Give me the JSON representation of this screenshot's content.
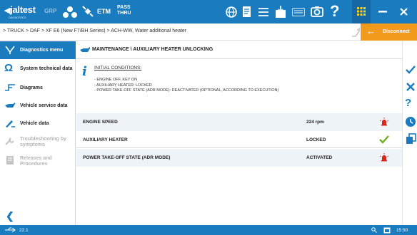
{
  "topbar": {
    "logo_brand": "jaltest",
    "logo_sub": "DIAGNOSTICS",
    "grp": "GRP",
    "etm": "ETM",
    "pass": "PASS",
    "thru": "THRU"
  },
  "breadcrumb": "> TRUCK > DAF > XF E6 (New F7/BH Series) > ACH-WW, Water additional heater",
  "disconnect_label": "Disconnect",
  "sidebar": {
    "items": [
      {
        "label": "Diagnostics menu"
      },
      {
        "label": "System technical data"
      },
      {
        "label": "Diagrams"
      },
      {
        "label": "Vehicle service data"
      },
      {
        "label": "Vehicle data"
      },
      {
        "label": "Troubleshooting by symptoms"
      },
      {
        "label": "Releases and Procedures"
      }
    ]
  },
  "procedure": {
    "title": "MAINTENANCE \\ AUXILIARY HEATER UNLOCKING",
    "conditions_title": "INITIAL CONDITIONS:",
    "conditions": [
      "- ENGINE OFF, KEY ON",
      "- AUXILIARY HEATER: LOCKED",
      "- POWER TAKE-OFF STATE (ADR MODE): DEACTIVATED (OPTIONAL, ACCORDING TO EXECUTION)"
    ]
  },
  "params": [
    {
      "name": "ENGINE SPEED",
      "value": "224 rpm",
      "status": "alarm"
    },
    {
      "name": "AUXILIARY HEATER",
      "value": "LOCKED",
      "status": "ok"
    },
    {
      "name": "POWER TAKE-OFF STATE (ADR MODE)",
      "value": "ACTIVATED",
      "status": "alarm"
    }
  ],
  "statusbar": {
    "version": "22.1",
    "time": "15:50"
  },
  "colors": {
    "primary": "#1a7bbf",
    "accent": "#f29a1b",
    "ok": "#6ab023",
    "alarm": "#d9261c"
  },
  "icons": [
    "usb-icon",
    "wifi-icon",
    "keyboard-icon",
    "list-icon",
    "document-icon",
    "globe-icon",
    "camera-icon",
    "help-icon",
    "apps-icon",
    "minimize-icon",
    "close-icon",
    "check-icon",
    "cross-icon",
    "question-icon",
    "clock-icon",
    "copy-icon",
    "info-icon",
    "alarm-icon"
  ]
}
